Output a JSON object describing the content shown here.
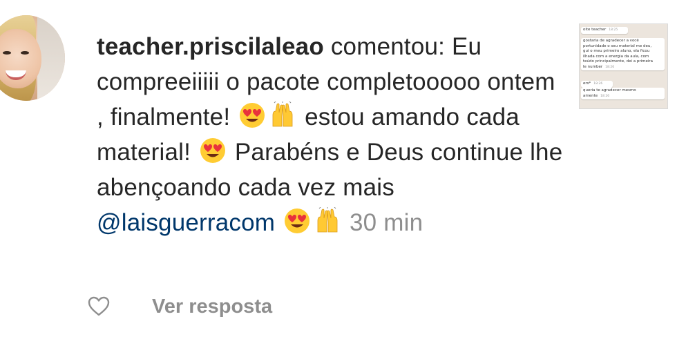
{
  "comment": {
    "username": "teacher.priscilaleao",
    "text_part1": " comentou: Eu compreeiiiii o pacote completooooo ontem , finalmente! ",
    "text_part2": " estou amando cada material! ",
    "text_part3": " Parabéns e Deus continue lhe abençoando cada vez mais ",
    "mention": "@laisguerracom",
    "timestamp": "30 min"
  },
  "actions": {
    "reply_label": "Ver resposta"
  },
  "attachment": {
    "bubble1": {
      "text": "oite teacher",
      "time": "18:25"
    },
    "bubble2": {
      "lines": [
        "gostaria de agradecer a você",
        "portunidade o seu material me deu,",
        "gui o meu primeiro aluno, ela ficou",
        "ilhada com a energia da aula, com",
        "teúdo principalmente, dei a primeira",
        "le number"
      ],
      "time": "18:26"
    },
    "bubble3": {
      "text": "ers*",
      "time": "18:26"
    },
    "bubble4": {
      "lines": [
        "queria te agradecer mesmo",
        "amente"
      ],
      "time": "18:26"
    }
  },
  "icons": {
    "heart": "heart-outline-icon",
    "heart_eyes": "heart-eyes-emoji",
    "raising_hands": "raising-hands-emoji"
  },
  "colors": {
    "text": "#262626",
    "mention": "#00376b",
    "muted": "#8e8e8e"
  }
}
